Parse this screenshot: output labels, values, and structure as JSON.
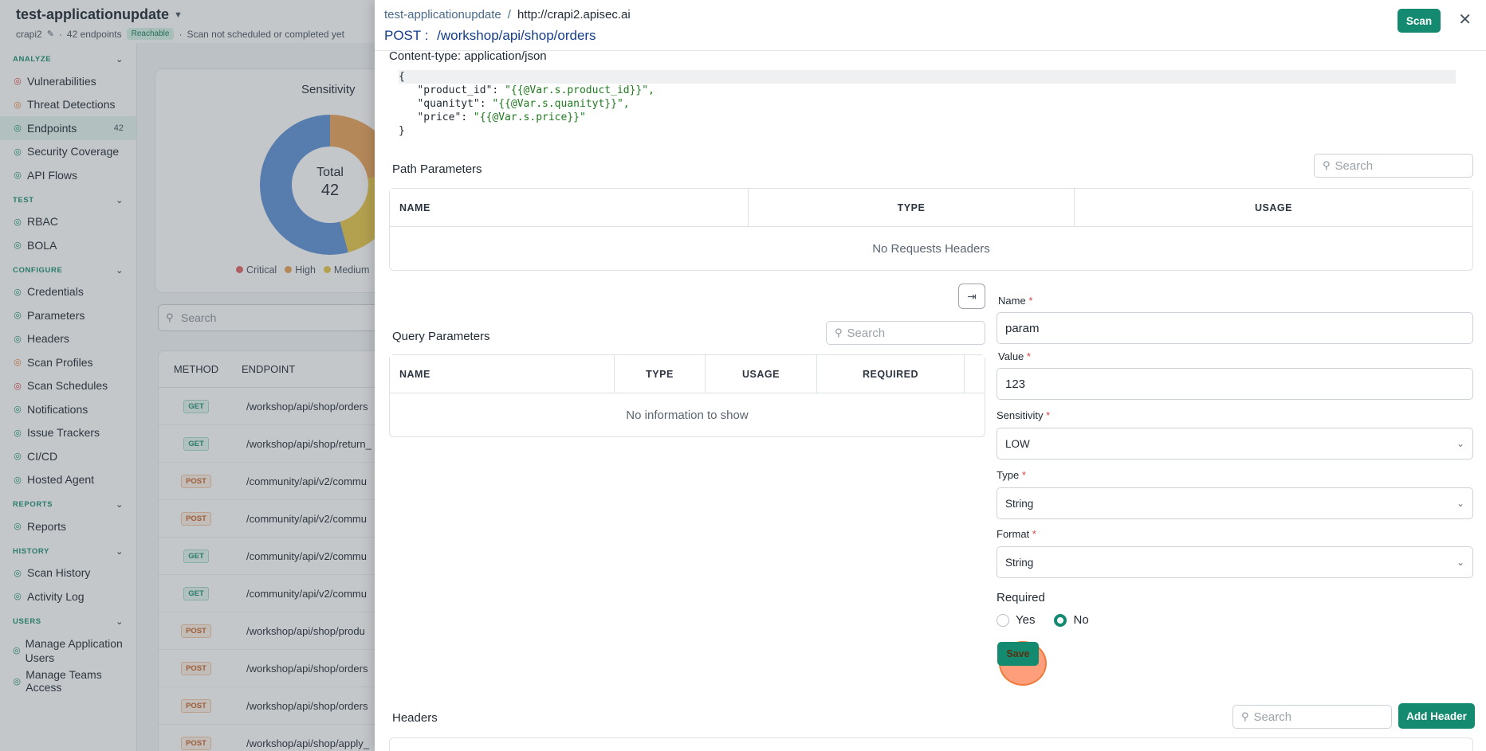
{
  "app": {
    "title": "test-applicationupdate",
    "project": "crapi2",
    "endpoints_count": "42 endpoints",
    "status_badge": "Reachable",
    "scan_status": "Scan not scheduled or completed yet"
  },
  "sidebar": {
    "sections": [
      {
        "label": "ANALYZE",
        "items": [
          {
            "label": "Vulnerabilities",
            "icon": "bug-icon"
          },
          {
            "label": "Threat Detections",
            "icon": "radar-icon"
          },
          {
            "label": "Endpoints",
            "icon": "endpoints-icon",
            "count": "42",
            "active": true
          },
          {
            "label": "Security Coverage",
            "icon": "shield-icon"
          },
          {
            "label": "API Flows",
            "icon": "flow-icon"
          }
        ]
      },
      {
        "label": "TEST",
        "items": [
          {
            "label": "RBAC",
            "icon": "user-icon"
          },
          {
            "label": "BOLA",
            "icon": "shield-icon"
          }
        ]
      },
      {
        "label": "CONFIGURE",
        "items": [
          {
            "label": "Credentials",
            "icon": "key-icon"
          },
          {
            "label": "Parameters",
            "icon": "braces-icon"
          },
          {
            "label": "Headers",
            "icon": "list-icon"
          },
          {
            "label": "Scan Profiles",
            "icon": "gauge-icon"
          },
          {
            "label": "Scan Schedules",
            "icon": "calendar-icon"
          },
          {
            "label": "Notifications",
            "icon": "bell-icon"
          },
          {
            "label": "Issue Trackers",
            "icon": "tracker-icon"
          },
          {
            "label": "CI/CD",
            "icon": "cicd-icon"
          },
          {
            "label": "Hosted Agent",
            "icon": "server-icon"
          }
        ]
      },
      {
        "label": "REPORTS",
        "items": [
          {
            "label": "Reports",
            "icon": "document-icon"
          }
        ]
      },
      {
        "label": "HISTORY",
        "items": [
          {
            "label": "Scan History",
            "icon": "history-icon"
          },
          {
            "label": "Activity Log",
            "icon": "log-icon"
          }
        ]
      },
      {
        "label": "USERS",
        "items": [
          {
            "label": "Manage Application Users",
            "icon": "users-icon"
          },
          {
            "label": "Manage Teams Access",
            "icon": "team-icon"
          }
        ]
      }
    ]
  },
  "overview": {
    "card_title": "Sensitivity",
    "donut_label": "Total",
    "donut_value": "42",
    "legend": [
      {
        "label": "Critical",
        "color": "#e06666"
      },
      {
        "label": "High",
        "color": "#e9a35a"
      },
      {
        "label": "Medium",
        "color": "#e8c84a"
      }
    ],
    "search_placeholder": "Search",
    "table_headers": [
      "METHOD",
      "ENDPOINT"
    ],
    "rows": [
      {
        "method": "GET",
        "endpoint": "/workshop/api/shop/orders"
      },
      {
        "method": "GET",
        "endpoint": "/workshop/api/shop/return_"
      },
      {
        "method": "POST",
        "endpoint": "/community/api/v2/commu"
      },
      {
        "method": "POST",
        "endpoint": "/community/api/v2/commu"
      },
      {
        "method": "GET",
        "endpoint": "/community/api/v2/commu"
      },
      {
        "method": "GET",
        "endpoint": "/community/api/v2/commu"
      },
      {
        "method": "POST",
        "endpoint": "/workshop/api/shop/produ"
      },
      {
        "method": "POST",
        "endpoint": "/workshop/api/shop/orders"
      },
      {
        "method": "POST",
        "endpoint": "/workshop/api/shop/orders"
      },
      {
        "method": "POST",
        "endpoint": "/workshop/api/shop/apply_"
      }
    ]
  },
  "drawer": {
    "breadcrumb_app": "test-applicationupdate",
    "breadcrumb_sep": "/",
    "breadcrumb_host": "http://crapi2.apisec.ai",
    "method_prefix": "POST :",
    "endpoint_path": "/workshop/api/shop/orders",
    "scan_label": "Scan",
    "close_glyph": "✕",
    "content_type": "Content-type: application/json",
    "body_lines": [
      {
        "text": "{",
        "key": "",
        "val": ""
      },
      {
        "text": "",
        "key": "   \"product_id\": ",
        "val": "\"{{@Var.s.product_id}}\","
      },
      {
        "text": "",
        "key": "   \"quanityt\": ",
        "val": "\"{{@Var.s.quanityt}}\","
      },
      {
        "text": "",
        "key": "   \"price\": ",
        "val": "\"{{@Var.s.price}}\""
      },
      {
        "text": "}",
        "key": "",
        "val": ""
      }
    ],
    "path_params": {
      "title": "Path Parameters",
      "search_placeholder": "Search",
      "headers": [
        "NAME",
        "TYPE",
        "USAGE"
      ],
      "empty": "No Requests Headers"
    },
    "query_params": {
      "title": "Query Parameters",
      "search_placeholder": "Search",
      "headers": [
        "NAME",
        "TYPE",
        "USAGE",
        "REQUIRED"
      ],
      "empty": "No information to show"
    },
    "form": {
      "name_label": "Name",
      "name_value": "param",
      "value_label": "Value",
      "value_value": "123",
      "sensitivity_label": "Sensitivity",
      "sensitivity_value": "LOW",
      "type_label": "Type",
      "type_value": "String",
      "format_label": "Format",
      "format_value": "String",
      "required_label": "Required",
      "required_yes": "Yes",
      "required_no": "No",
      "required_selected": "No",
      "save_label": "Save",
      "required_mark": "*"
    },
    "headers_section": {
      "title": "Headers",
      "search_placeholder": "Search",
      "add_label": "Add Header"
    }
  }
}
